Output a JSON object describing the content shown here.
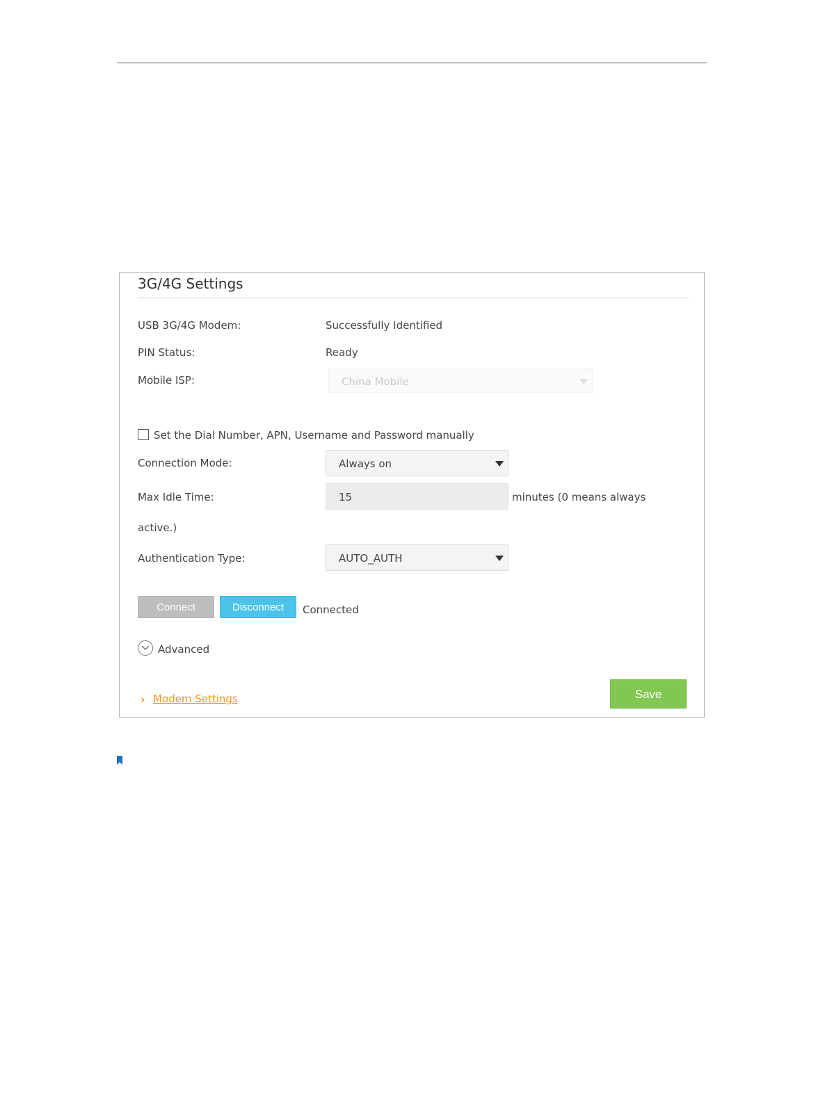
{
  "panel": {
    "title": "3G/4G Settings",
    "usb_modem_label": "USB 3G/4G Modem:",
    "usb_modem_value": "Successfully Identified",
    "pin_status_label": "PIN Status:",
    "pin_status_value": "Ready",
    "mobile_isp_label": "Mobile ISP:",
    "mobile_isp_value": "China Mobile",
    "manual_checkbox_label": "Set the Dial Number, APN, Username and Password manually",
    "manual_checkbox_checked": false,
    "connection_mode_label": "Connection Mode:",
    "connection_mode_value": "Always on",
    "max_idle_label": "Max Idle Time:",
    "max_idle_value": "15",
    "max_idle_hint": "minutes (0 means always",
    "max_idle_hint_cont": "active.)",
    "auth_type_label": "Authentication Type:",
    "auth_type_value": "AUTO_AUTH",
    "connect_label": "Connect",
    "disconnect_label": "Disconnect",
    "connection_status": "Connected",
    "advanced_label": "Advanced",
    "modem_settings_link": "Modem Settings",
    "save_label": "Save"
  },
  "colors": {
    "accent_blue": "#4cc4ea",
    "save_green": "#82c751",
    "link_orange": "#f7941d",
    "disabled_gray": "#bdbdbd"
  },
  "icons": {
    "advanced": "chevron-down-circle-icon",
    "modem_settings": "chevron-right-icon",
    "note": "bookmark-icon"
  }
}
